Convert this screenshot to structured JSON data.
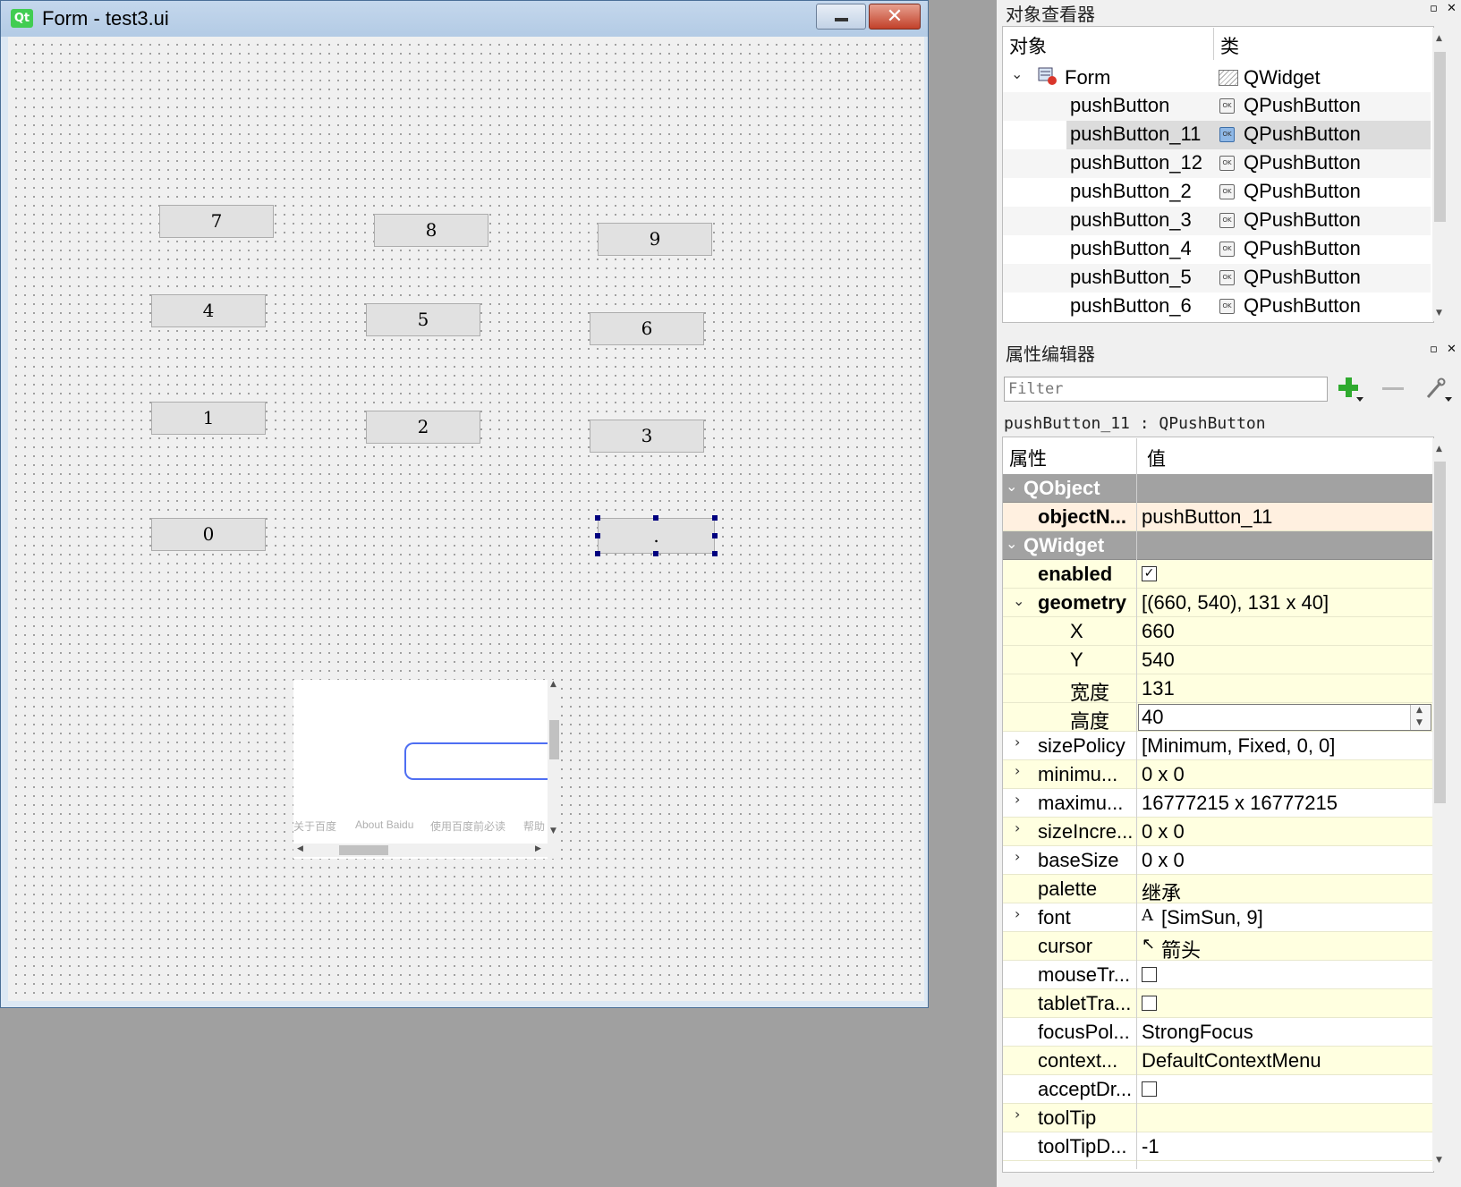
{
  "form_window": {
    "title": "Form - test3.ui",
    "logo_text": "Qt",
    "minimize_icon": "minimize-icon",
    "close_icon": "close-icon",
    "close_glyph": "✕"
  },
  "calculator_buttons": [
    {
      "label": "7"
    },
    {
      "label": "8"
    },
    {
      "label": "9"
    },
    {
      "label": "4"
    },
    {
      "label": "5"
    },
    {
      "label": "6"
    },
    {
      "label": "1"
    },
    {
      "label": "2"
    },
    {
      "label": "3"
    },
    {
      "label": "0"
    },
    {
      "label": "."
    }
  ],
  "web_view": {
    "links": [
      "关于百度",
      "About Baidu",
      "使用百度前必读",
      "帮助"
    ]
  },
  "object_inspector": {
    "title": "对象查看器",
    "float_glyph": "▫",
    "close_glyph": "✕",
    "columns": {
      "object": "对象",
      "class": "类"
    },
    "root": {
      "name": "Form",
      "class": "QWidget",
      "expand_glyph": "⌄"
    },
    "rows": [
      {
        "name": "pushButton",
        "class": "QPushButton"
      },
      {
        "name": "pushButton_11",
        "class": "QPushButton",
        "selected": true
      },
      {
        "name": "pushButton_12",
        "class": "QPushButton"
      },
      {
        "name": "pushButton_2",
        "class": "QPushButton"
      },
      {
        "name": "pushButton_3",
        "class": "QPushButton"
      },
      {
        "name": "pushButton_4",
        "class": "QPushButton"
      },
      {
        "name": "pushButton_5",
        "class": "QPushButton"
      },
      {
        "name": "pushButton_6",
        "class": "QPushButton"
      }
    ],
    "ok_icon_text": "OK"
  },
  "property_editor": {
    "title": "属性编辑器",
    "filter_placeholder": "Filter",
    "selected_object": "pushButton_11 : QPushButton",
    "columns": {
      "property": "属性",
      "value": "值"
    },
    "add_icon": "plus-icon",
    "remove_icon": "minus-icon",
    "config_icon": "wrench-icon",
    "rows": [
      {
        "kind": "section",
        "name": "QObject",
        "expander": "⌄"
      },
      {
        "kind": "orange",
        "name": "objectN...",
        "bold": true,
        "value": "pushButton_11"
      },
      {
        "kind": "section",
        "name": "QWidget",
        "expander": "⌄"
      },
      {
        "kind": "yellow",
        "name": "enabled",
        "bold": true,
        "checkbox": true,
        "checked": true
      },
      {
        "kind": "yellow",
        "name": "geometry",
        "bold": true,
        "value": "[(660, 540), 131 x 40]",
        "expander": "⌄"
      },
      {
        "kind": "yellow",
        "name": "X",
        "sub": true,
        "value": "660"
      },
      {
        "kind": "yellow",
        "name": "Y",
        "sub": true,
        "value": "540"
      },
      {
        "kind": "yellow",
        "name": "宽度",
        "sub": true,
        "value": "131"
      },
      {
        "kind": "editing",
        "name": "高度",
        "sub": true,
        "value": "40"
      },
      {
        "kind": "white",
        "name": "sizePolicy",
        "value": "[Minimum, Fixed, 0, 0]",
        "expander": "›"
      },
      {
        "kind": "yellow",
        "name": "minimu...",
        "value": "0 x 0",
        "expander": "›"
      },
      {
        "kind": "white",
        "name": "maximu...",
        "value": "16777215 x 16777215",
        "expander": "›"
      },
      {
        "kind": "yellow",
        "name": "sizeIncre...",
        "value": "0 x 0",
        "expander": "›"
      },
      {
        "kind": "white",
        "name": "baseSize",
        "value": "0 x 0",
        "expander": "›"
      },
      {
        "kind": "yellow",
        "name": "palette",
        "value": "继承"
      },
      {
        "kind": "white",
        "name": "font",
        "value": "[SimSun, 9]",
        "prefix": "A",
        "expander": "›"
      },
      {
        "kind": "yellow",
        "name": "cursor",
        "value": "箭头",
        "prefix": "↖"
      },
      {
        "kind": "white",
        "name": "mouseTr...",
        "checkbox": true,
        "checked": false
      },
      {
        "kind": "yellow",
        "name": "tabletTra...",
        "checkbox": true,
        "checked": false
      },
      {
        "kind": "white",
        "name": "focusPol...",
        "value": "StrongFocus"
      },
      {
        "kind": "yellow",
        "name": "context...",
        "value": "DefaultContextMenu"
      },
      {
        "kind": "white",
        "name": "acceptDr...",
        "checkbox": true,
        "checked": false
      },
      {
        "kind": "yellow",
        "name": "toolTip",
        "value": "",
        "expander": "›"
      },
      {
        "kind": "white",
        "name": "toolTipD...",
        "value": "-1"
      }
    ],
    "spin_up": "▲",
    "spin_down": "▼"
  },
  "colors": {
    "qt_green": "#41cd52",
    "selection_handle": "#00007f",
    "property_yellow": "#ffffe0",
    "section_gray": "#a2a2a2",
    "search_border": "#4e6ef2"
  }
}
